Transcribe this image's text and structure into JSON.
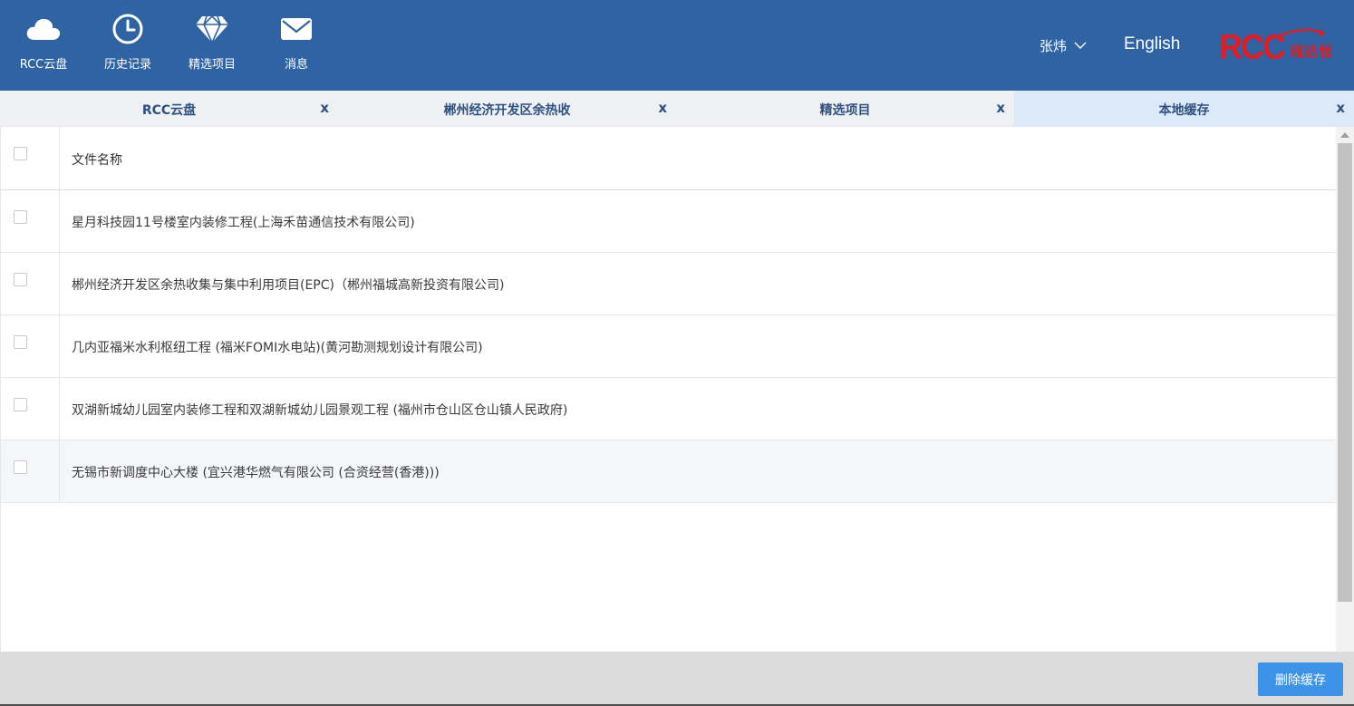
{
  "nav": {
    "items": [
      {
        "label": "RCC云盘",
        "icon": "cloud-icon"
      },
      {
        "label": "历史记录",
        "icon": "clock-icon"
      },
      {
        "label": "精选项目",
        "icon": "diamond-icon"
      },
      {
        "label": "消息",
        "icon": "mail-icon"
      }
    ]
  },
  "header": {
    "user_name": "张炜",
    "language_link": "English",
    "logo_text": "RCC",
    "logo_cn": "瑞达恒"
  },
  "tabs": [
    {
      "label": "RCC云盘",
      "close": "x",
      "active": false
    },
    {
      "label": "郴州经济开发区余热收",
      "close": "x",
      "active": false
    },
    {
      "label": "精选项目",
      "close": "x",
      "active": false
    },
    {
      "label": "本地缓存",
      "close": "x",
      "active": true
    }
  ],
  "table": {
    "header": "文件名称",
    "rows": [
      "星月科技园11号楼室内装修工程(上海禾苗通信技术有限公司)",
      "郴州经济开发区余热收集与集中利用项目(EPC)（郴州福城高新投资有限公司)",
      "几内亚福米水利枢纽工程 (福米FOMI水电站)(黄河勘测规划设计有限公司)",
      "双湖新城幼儿园室内装修工程和双湖新城幼儿园景观工程 (福州市仓山区仓山镇人民政府)",
      "无锡市新调度中心大楼 (宜兴港华燃气有限公司 (合资经营(香港)))"
    ]
  },
  "footer": {
    "delete_cache_label": "删除缓存"
  },
  "colors": {
    "header_bg": "#2f63a3",
    "active_tab_bg": "#dbe9f8",
    "tab_text": "#2f5180",
    "logo_red": "#e31b23",
    "button_blue": "#3c93e8",
    "footer_bg": "#dcdbdc"
  }
}
